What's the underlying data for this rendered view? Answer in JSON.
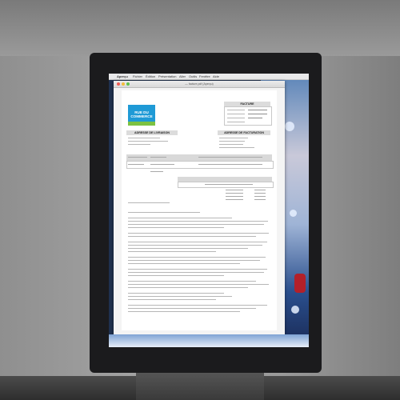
{
  "scene": {
    "description_ok": false
  },
  "menubar": {
    "items": [
      "Aperçu",
      "Fichier",
      "Édition",
      "Présentation",
      "Aller",
      "Outils",
      "Fenêtre",
      "Aide"
    ]
  },
  "window": {
    "title": "— facture.pdf (Aperçu)"
  },
  "document": {
    "logo_line1": "RUE DU",
    "logo_line2": "COMMERCE",
    "invoice_header": "FACTURE",
    "shipping_header": "ADRESSE DE LIVRAISON",
    "billing_header": "ADRESSE DE FACTURATION"
  },
  "colors": {
    "logo_blue": "#1f9ad6",
    "logo_green": "#7dc242",
    "monitor_bezel": "#1b1b1d"
  }
}
